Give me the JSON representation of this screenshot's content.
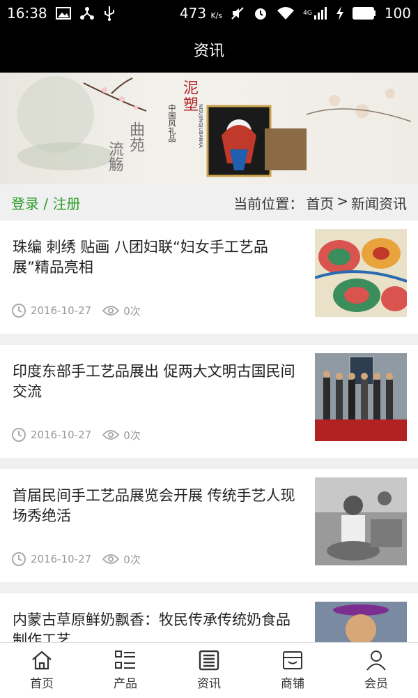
{
  "status_bar": {
    "time": "16:38",
    "network_speed": "473",
    "network_speed_unit": "K/s",
    "signal_label": "4G",
    "battery": "100"
  },
  "header": {
    "title": "资讯"
  },
  "banner": {
    "title_main": "泥塑",
    "subtitle_pinyin": "NISUJINGJUBANKA",
    "subtitle_cn": "中国风礼品",
    "left_text_1": "曲苑",
    "left_text_2": "流觞"
  },
  "location_bar": {
    "login_link": "登录 / 注册",
    "location_prefix": "当前位置：",
    "breadcrumb_home": "首页",
    "breadcrumb_sep": ">",
    "breadcrumb_current": "新闻资讯"
  },
  "news": [
    {
      "title": "珠编 刺绣 贴画 八团妇联“妇女手工艺品展”精品亮相",
      "date": "2016-10-27",
      "views": "0次"
    },
    {
      "title": "印度东部手工艺品展出 促两大文明古国民间交流",
      "date": "2016-10-27",
      "views": "0次"
    },
    {
      "title": "首届民间手工艺品展览会开展 传统手艺人现场秀绝活",
      "date": "2016-10-27",
      "views": "0次"
    },
    {
      "title": "内蒙古草原鲜奶飘香：牧民传承传统奶食品制作工艺",
      "date": "",
      "views": ""
    }
  ],
  "bottom_nav": [
    {
      "label": "首页",
      "icon": "home-icon"
    },
    {
      "label": "产品",
      "icon": "list-icon"
    },
    {
      "label": "资讯",
      "icon": "news-icon"
    },
    {
      "label": "商铺",
      "icon": "store-icon"
    },
    {
      "label": "会员",
      "icon": "user-icon"
    }
  ]
}
